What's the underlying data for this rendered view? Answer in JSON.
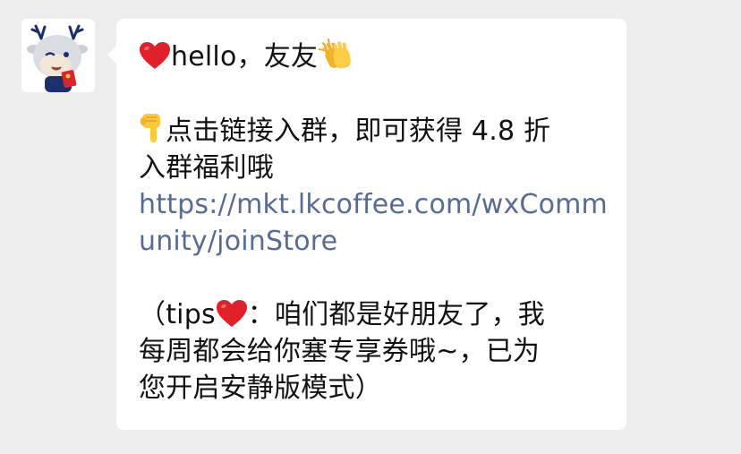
{
  "contact": {
    "avatar_icon": "deer-mascot-avatar-icon"
  },
  "message": {
    "greeting_text": "hello，友友",
    "instruction_line1": "点击链接入群，即可获得 4.8 折",
    "instruction_line2": "入群福利哦",
    "link_line1": "https://mkt.lkcoffee.com/wxComm",
    "link_line2": "unity/joinStore",
    "tips_open": "（tips",
    "tips_line1_rest": "：咱们都是好朋友了，我",
    "tips_line2": "每周都会给你塞专享券哦~，已为",
    "tips_line3": "您开启安静版模式）"
  },
  "icons": {
    "heart": "red-heart-icon",
    "clap": "clapping-hands-icon",
    "point_down": "pointing-down-hand-icon"
  },
  "colors": {
    "background": "#ededed",
    "bubble": "#ffffff",
    "text": "#111111",
    "link": "#576b95",
    "heart": "#e0202a",
    "hand": "#ffc83d"
  }
}
